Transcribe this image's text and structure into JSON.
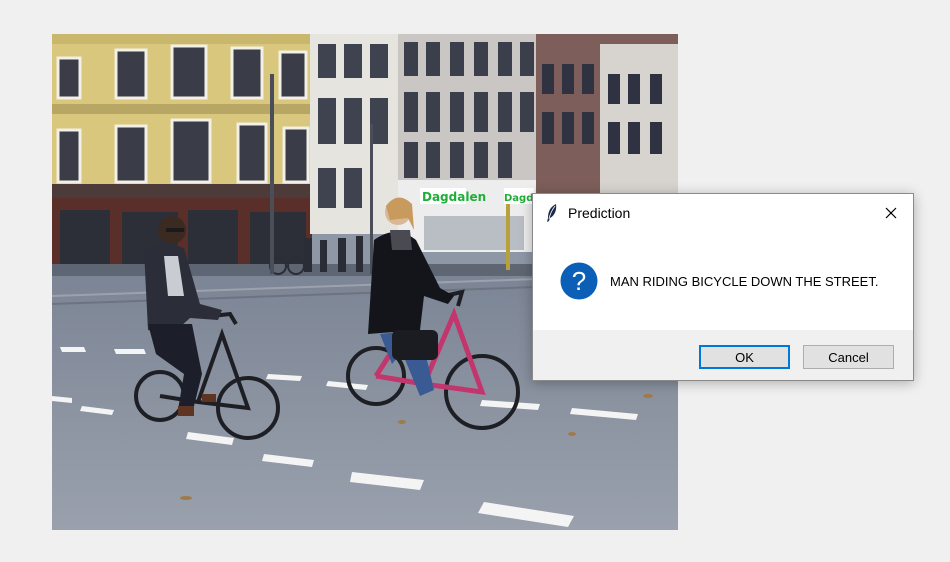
{
  "dialog": {
    "title": "Prediction",
    "app_icon": "feather-icon",
    "close_icon": "close-icon",
    "message_icon": "question-icon",
    "message": "MAN RIDING BICYCLE DOWN THE STREET.",
    "ok_label": "OK",
    "cancel_label": "Cancel",
    "accent_color": "#0078d7",
    "icon_color": "#0063b1"
  },
  "photo": {
    "subject": "street-photo",
    "shop_sign": "Dagdalen"
  }
}
